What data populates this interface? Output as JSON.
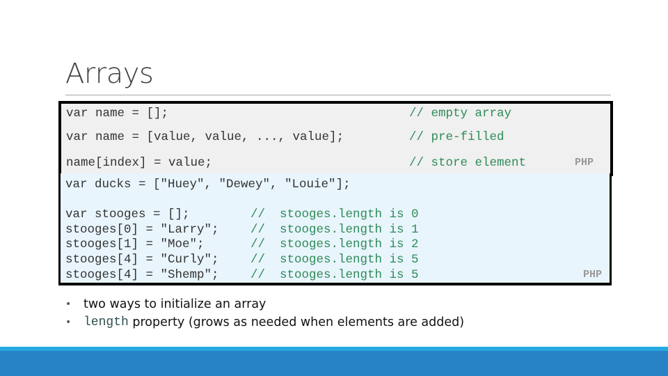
{
  "slide": {
    "title": "Arrays"
  },
  "code_block_1": {
    "lines": [
      {
        "code": "var name = [];",
        "comment": "// empty array"
      },
      {
        "code": "var name = [value, value, ..., value];",
        "comment": "// pre-filled"
      },
      {
        "code": "name[index] = value;",
        "comment": "// store element"
      }
    ],
    "language_badge": "PHP"
  },
  "code_block_2": {
    "first_line": "var ducks = [\"Huey\", \"Dewey\", \"Louie\"];",
    "lines": [
      {
        "code": "var stooges = [];",
        "comment": "//  stooges.length is 0"
      },
      {
        "code": "stooges[0] = \"Larry\";",
        "comment": "//  stooges.length is 1"
      },
      {
        "code": "stooges[1] = \"Moe\";",
        "comment": "//  stooges.length is 2"
      },
      {
        "code": "stooges[4] = \"Curly\";",
        "comment": "//  stooges.length is 5"
      },
      {
        "code": "stooges[4] = \"Shemp\";",
        "comment": "//  stooges.length is 5"
      }
    ],
    "language_badge": "PHP"
  },
  "bullets": [
    {
      "mono": "",
      "text": "two ways to initialize an array"
    },
    {
      "mono": "length",
      "text": " property (grows as needed when elements are added)"
    }
  ],
  "colors": {
    "comment": "#2e8b57",
    "box1_bg": "#f0f0f0",
    "box2_bg": "#e9f5fd",
    "footer_light": "#26a9e0",
    "footer_dark": "#2782c6"
  }
}
